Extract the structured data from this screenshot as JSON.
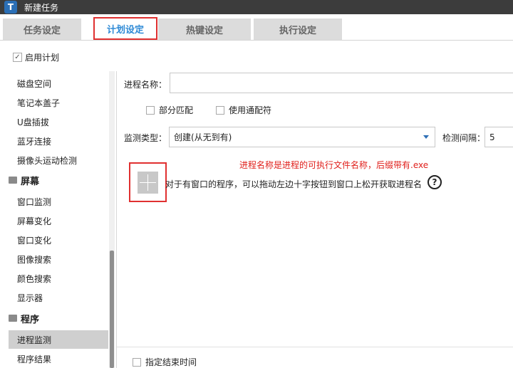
{
  "window": {
    "title": "新建任务",
    "logo": "T"
  },
  "tabs": [
    {
      "label": "任务设定"
    },
    {
      "label": "计划设定"
    },
    {
      "label": "热键设定"
    },
    {
      "label": "执行设定"
    }
  ],
  "enable_plan": {
    "label": "启用计划",
    "checked": true
  },
  "sidebar": {
    "items_top": [
      "磁盘空间",
      "笔记本盖子",
      "U盘插拔",
      "蓝牙连接",
      "摄像头运动检测"
    ],
    "cat_screen": "屏幕",
    "items_screen": [
      "窗口监测",
      "屏幕变化",
      "窗口变化",
      "图像搜索",
      "颜色搜索",
      "显示器"
    ],
    "cat_program": "程序",
    "items_program": [
      "进程监测",
      "程序结果"
    ]
  },
  "form": {
    "process_name_label": "进程名称：",
    "process_name_value": "",
    "partial_match_label": "部分匹配",
    "wildcard_label": "使用通配符",
    "monitor_type_label": "监测类型：",
    "monitor_type_value": "创建(从无到有)",
    "interval_label": "检测间隔：",
    "interval_value": "5",
    "warning_text": "进程名称是进程的可执行文件名称，后缀带有.exe",
    "hint_text": "对于有窗口的程序，可以拖动左边十字按钮到窗口上松开获取进程名",
    "help_glyph": "?",
    "end_time_label": "指定结束时间"
  },
  "colors": {
    "accent": "#2e8ad6",
    "highlight": "#e03030",
    "warning": "#e0201c"
  }
}
